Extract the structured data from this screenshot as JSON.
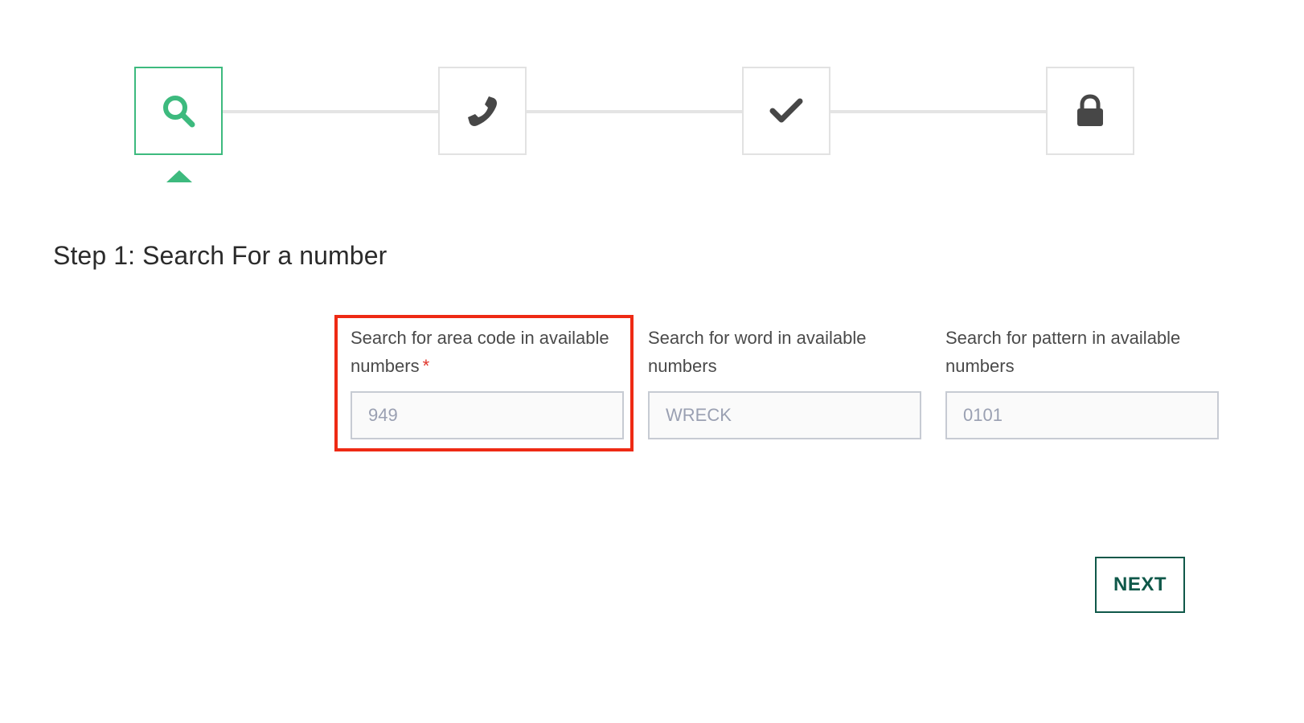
{
  "stepper": {
    "steps": [
      {
        "icon": "search-icon",
        "state": "active"
      },
      {
        "icon": "phone-icon",
        "state": "inactive"
      },
      {
        "icon": "check-icon",
        "state": "inactive"
      },
      {
        "icon": "lock-icon",
        "state": "inactive"
      }
    ],
    "active_color": "#3dba7e",
    "inactive_icon_color": "#474747"
  },
  "page": {
    "title": "Step 1: Search For a number"
  },
  "fields": {
    "area_code": {
      "label": "Search for area code in available numbers",
      "required_marker": "*",
      "placeholder": "949",
      "value": ""
    },
    "word": {
      "label": "Search for word in available numbers",
      "placeholder": "WRECK",
      "value": ""
    },
    "pattern": {
      "label": "Search for pattern in available numbers",
      "placeholder": "0101",
      "value": ""
    }
  },
  "actions": {
    "next_label": "NEXT"
  },
  "colors": {
    "highlight": "#ee2a14",
    "required": "#e0342a",
    "button": "#0f5849"
  }
}
